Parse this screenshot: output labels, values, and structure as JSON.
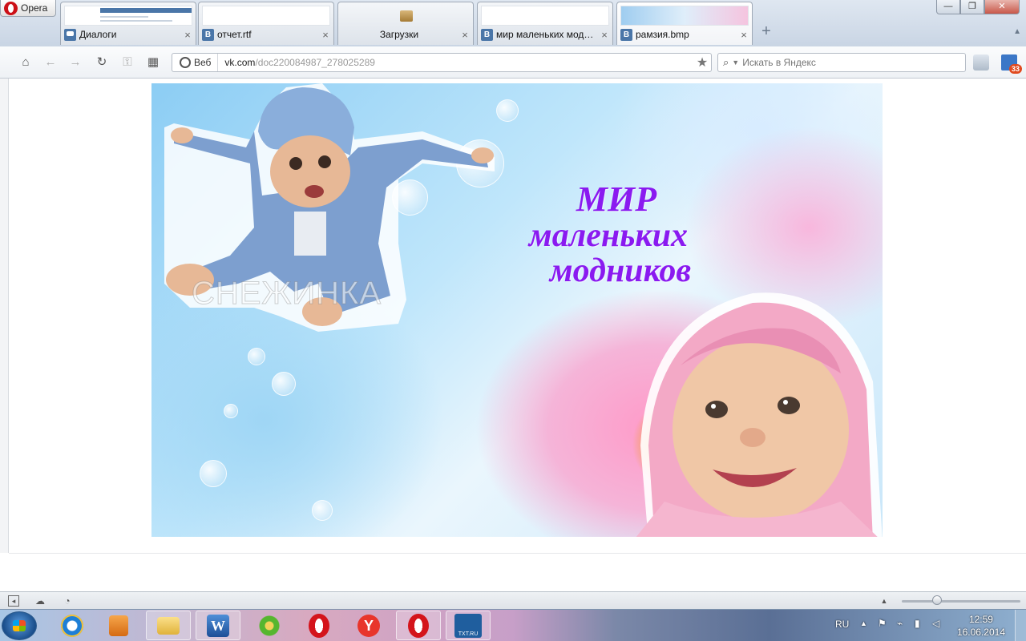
{
  "browser": {
    "menu_label": "Opera",
    "tabs": [
      {
        "label": "Диалоги",
        "favicon": "dialogs-icon"
      },
      {
        "label": "отчет.rtf",
        "favicon": "vk-icon"
      },
      {
        "label": "Загрузки",
        "favicon": "downloads-icon"
      },
      {
        "label": "мир маленьких моднико",
        "favicon": "vk-icon"
      },
      {
        "label": "рамзия.bmp",
        "favicon": "vk-icon"
      }
    ],
    "active_tab_index": 4,
    "vk_letter": "B"
  },
  "navbar": {
    "web_label": "Веб",
    "url_host": "vk.com",
    "url_path": "/doc220084987_278025289",
    "search_placeholder": "Искать в Яндекс",
    "mail_badge": "33"
  },
  "document": {
    "title_line1": "МИР",
    "title_line2": "маленьких",
    "title_line3": "модников",
    "watermark": "СНЕЖИНКА",
    "title_color": "#8a1af0"
  },
  "statusbar": {
    "zoom_fraction": 0.3
  },
  "taskbar": {
    "apps": [
      {
        "name": "internet-explorer-icon"
      },
      {
        "name": "media-player-icon"
      },
      {
        "name": "file-explorer-icon"
      },
      {
        "name": "word-icon"
      },
      {
        "name": "icq-icon"
      },
      {
        "name": "opera-icon"
      },
      {
        "name": "yandex-browser-icon"
      },
      {
        "name": "opera-icon"
      },
      {
        "name": "txt-ru-icon"
      }
    ],
    "txt_label": "TXT.RU",
    "word_letter": "W",
    "language": "RU",
    "time": "12:59",
    "date": "16.06.2014"
  }
}
